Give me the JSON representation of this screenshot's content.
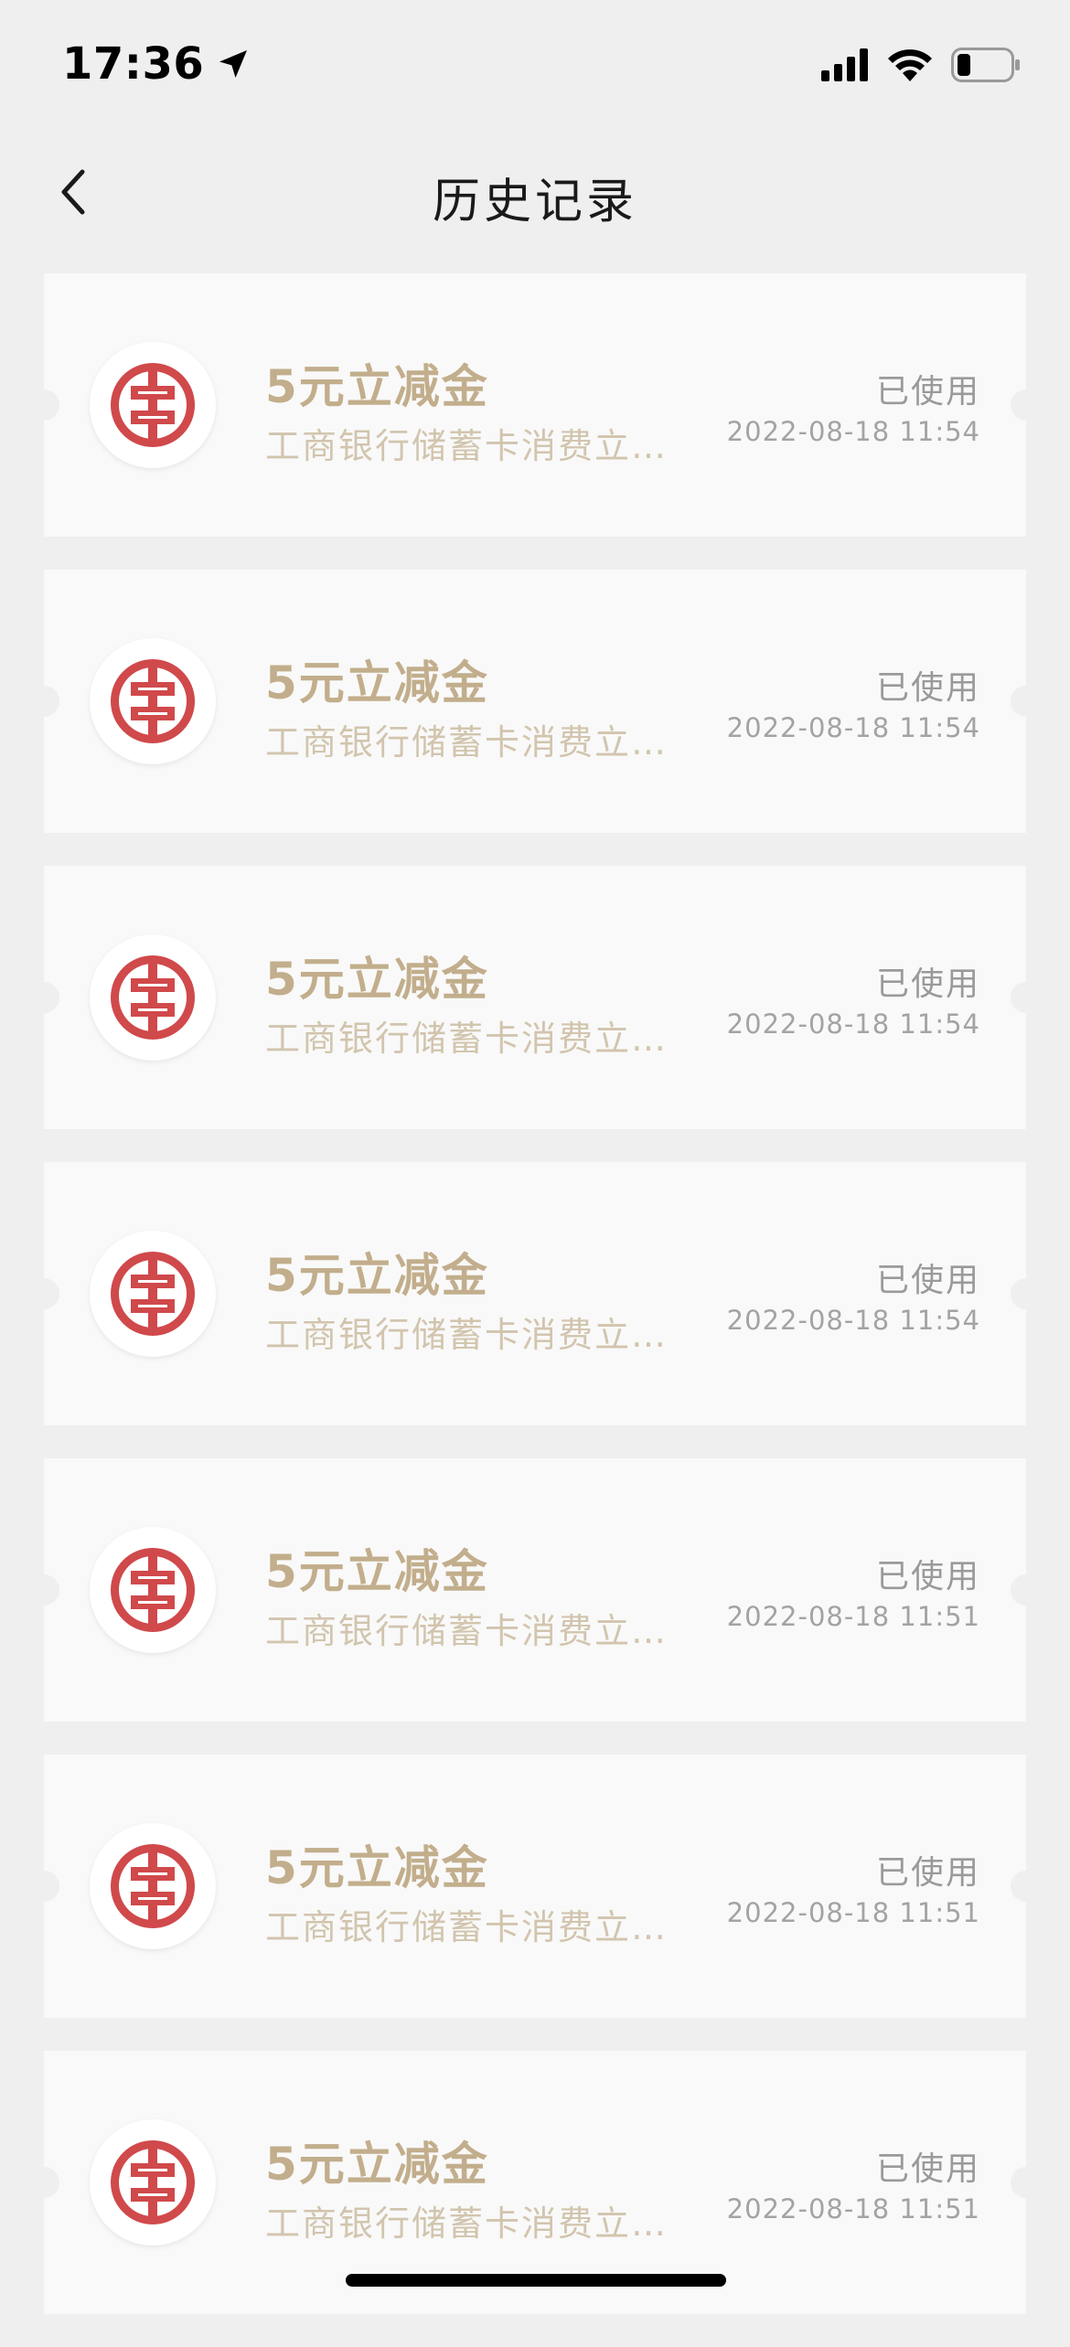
{
  "status_bar": {
    "time": "17:36"
  },
  "nav": {
    "title": "历史记录"
  },
  "colors": {
    "background": "#efefef",
    "card": "#f9f9f9",
    "coupon_title": "#c2ae8c",
    "coupon_desc": "#d2c5ae",
    "logo_red": "#d0494b"
  },
  "coupons": [
    {
      "title": "5元立减金",
      "desc": "工商银行储蓄卡消费立减金",
      "status": "已使用",
      "time": "2022-08-18 11:54",
      "icon": "icbc-logo-icon"
    },
    {
      "title": "5元立减金",
      "desc": "工商银行储蓄卡消费立减金",
      "status": "已使用",
      "time": "2022-08-18 11:54",
      "icon": "icbc-logo-icon"
    },
    {
      "title": "5元立减金",
      "desc": "工商银行储蓄卡消费立减金",
      "status": "已使用",
      "time": "2022-08-18 11:54",
      "icon": "icbc-logo-icon"
    },
    {
      "title": "5元立减金",
      "desc": "工商银行储蓄卡消费立减金",
      "status": "已使用",
      "time": "2022-08-18 11:54",
      "icon": "icbc-logo-icon"
    },
    {
      "title": "5元立减金",
      "desc": "工商银行储蓄卡消费立减金",
      "status": "已使用",
      "time": "2022-08-18 11:51",
      "icon": "icbc-logo-icon"
    },
    {
      "title": "5元立减金",
      "desc": "工商银行储蓄卡消费立减金",
      "status": "已使用",
      "time": "2022-08-18 11:51",
      "icon": "icbc-logo-icon"
    },
    {
      "title": "5元立减金",
      "desc": "工商银行储蓄卡消费立减金",
      "status": "已使用",
      "time": "2022-08-18 11:51",
      "icon": "icbc-logo-icon"
    }
  ]
}
